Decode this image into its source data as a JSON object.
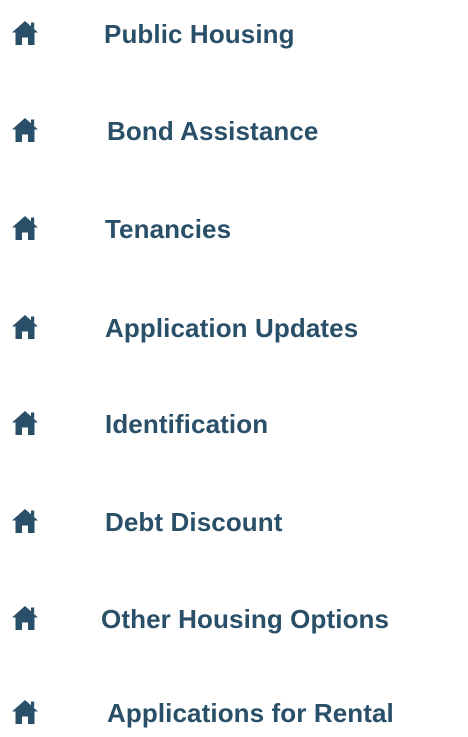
{
  "colors": {
    "text": "#2a4f68",
    "icon": "#2a4f68",
    "background": "#ffffff"
  },
  "menu": {
    "icon_name": "home-icon",
    "items": [
      {
        "label": "Public Housing"
      },
      {
        "label": "Bond Assistance"
      },
      {
        "label": "Tenancies"
      },
      {
        "label": "Application Updates"
      },
      {
        "label": "Identification"
      },
      {
        "label": "Debt Discount"
      },
      {
        "label": "Other Housing Options"
      },
      {
        "label": "Applications for Rental"
      }
    ]
  }
}
